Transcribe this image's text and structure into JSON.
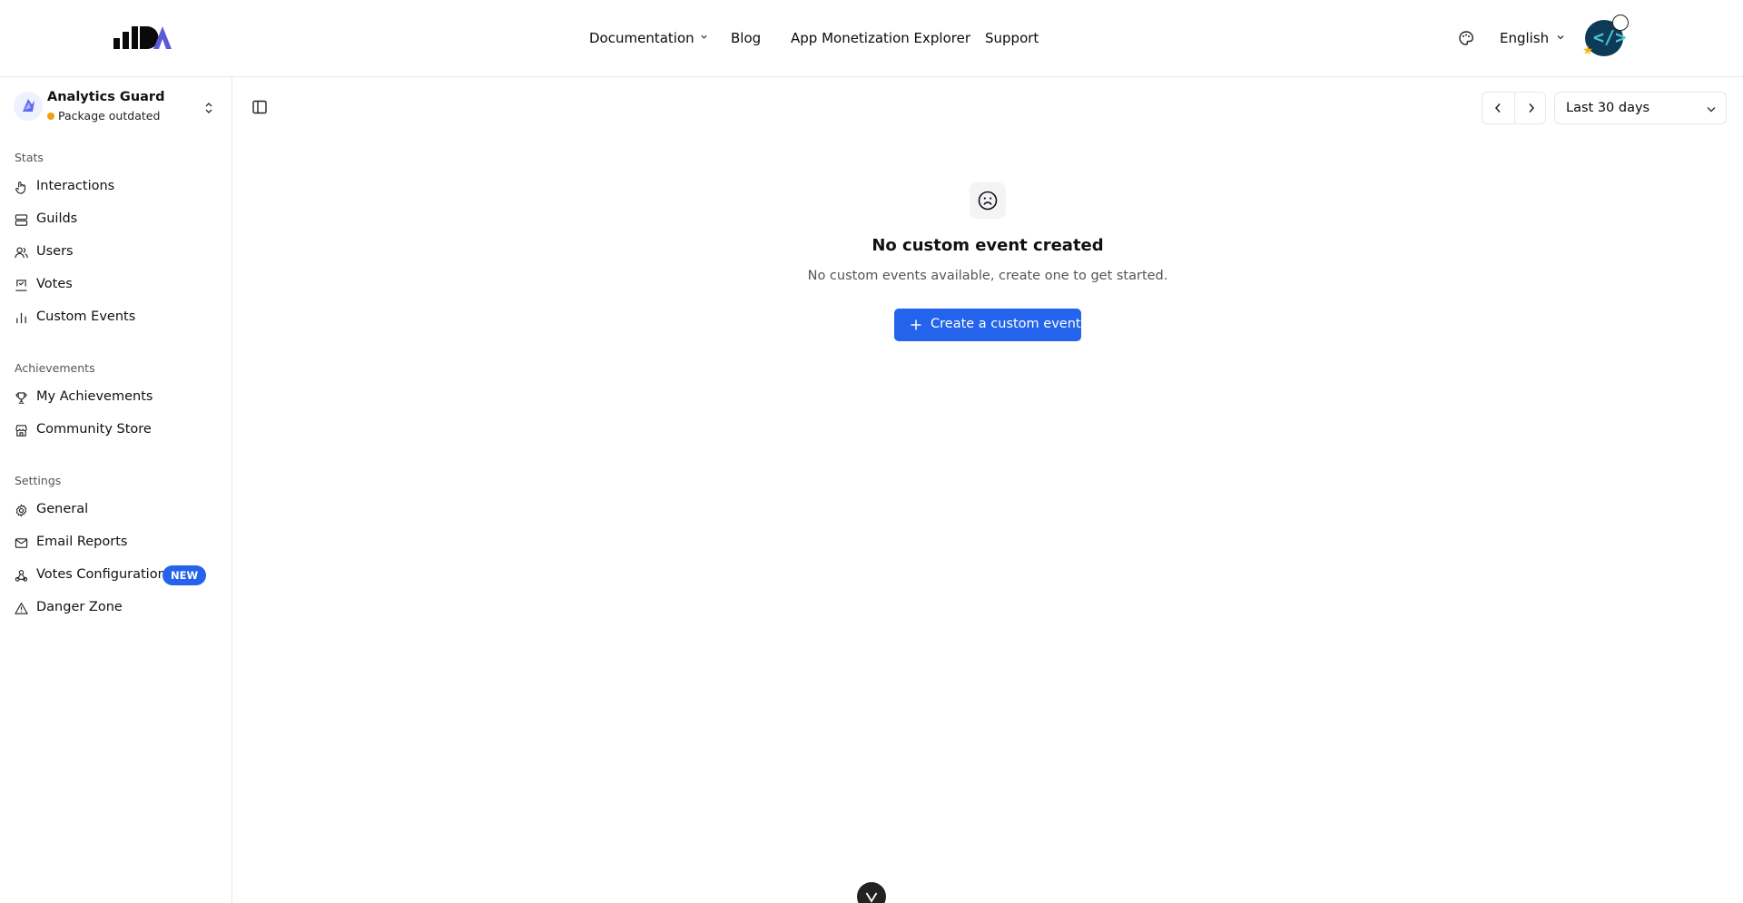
{
  "header": {
    "nav": [
      {
        "label": "Documentation",
        "has_dropdown": true
      },
      {
        "label": "Blog"
      },
      {
        "label": "App Monetization Explorer"
      },
      {
        "label": "Support"
      }
    ],
    "language": "English",
    "logo_color_accent": "#5b5bd6"
  },
  "sidebar": {
    "project": {
      "name": "Analytics Guard",
      "status": "Package outdated",
      "status_color": "#f59e0b"
    },
    "sections": [
      {
        "label": "Stats",
        "items": [
          {
            "label": "Interactions",
            "icon": "pointer-icon"
          },
          {
            "label": "Guilds",
            "icon": "server-icon"
          },
          {
            "label": "Users",
            "icon": "users-icon"
          },
          {
            "label": "Votes",
            "icon": "vote-icon"
          },
          {
            "label": "Custom Events",
            "icon": "bar-chart-icon"
          }
        ]
      },
      {
        "label": "Achievements",
        "items": [
          {
            "label": "My Achievements",
            "icon": "trophy-icon"
          },
          {
            "label": "Community Store",
            "icon": "store-icon"
          }
        ]
      },
      {
        "label": "Settings",
        "items": [
          {
            "label": "General",
            "icon": "gear-icon"
          },
          {
            "label": "Email Reports",
            "icon": "mail-icon"
          },
          {
            "label": "Votes Configuration",
            "icon": "webhook-icon",
            "badge": "NEW"
          },
          {
            "label": "Danger Zone",
            "icon": "warning-icon"
          }
        ]
      }
    ]
  },
  "main": {
    "date_range": "Last 30 days",
    "empty_state": {
      "title": "No custom event created",
      "subtitle": "No custom events available, create one to get started.",
      "button_label": "Create a custom event"
    }
  },
  "colors": {
    "primary": "#2463eb",
    "border": "#e5e7eb"
  }
}
